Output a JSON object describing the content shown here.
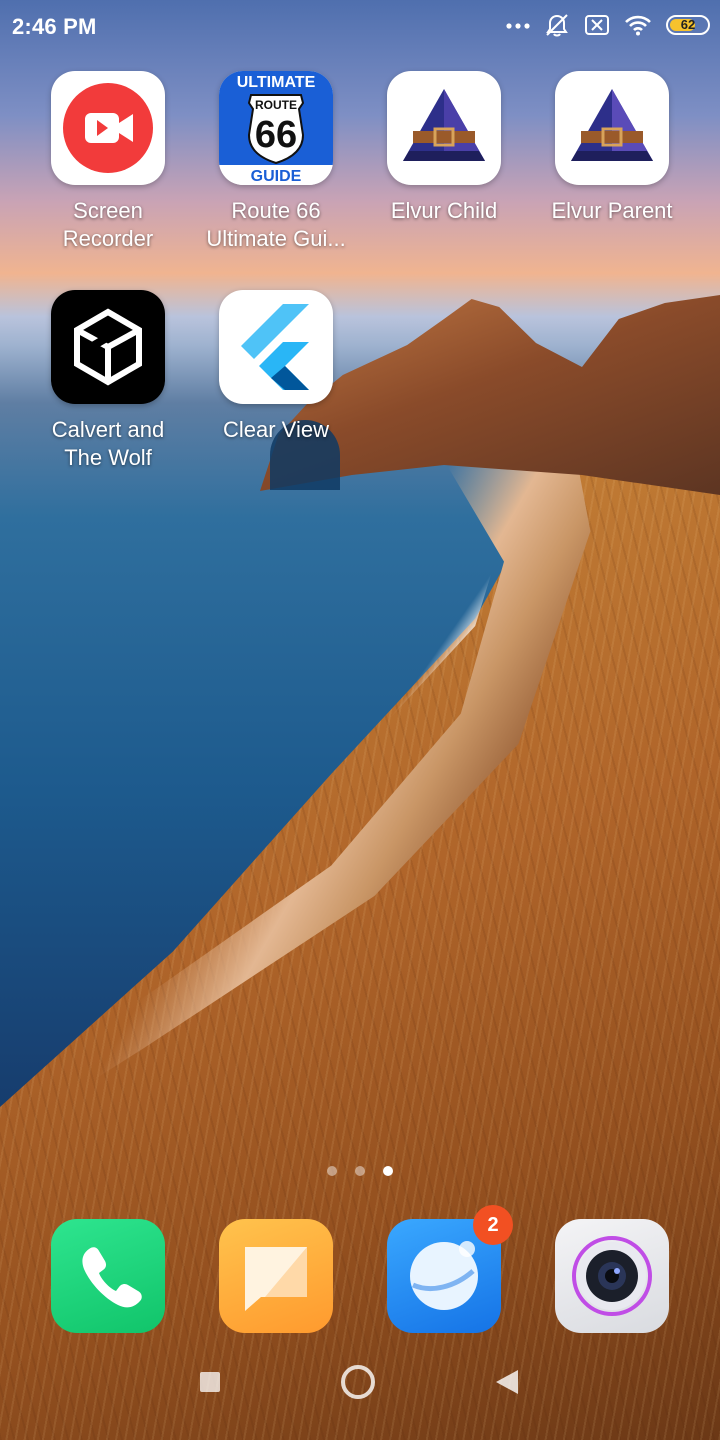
{
  "status_bar": {
    "time": "2:46 PM",
    "battery_level": "62",
    "icons": [
      "more-dots-icon",
      "silent-alarm-icon",
      "sim-x-icon",
      "wifi-icon",
      "battery-icon"
    ]
  },
  "apps": [
    {
      "label": "Screen\nRecorder",
      "icon": "screen-recorder-icon"
    },
    {
      "label": "Route 66\nUltimate Gui...",
      "icon": "route66-icon",
      "icon_text": {
        "top": "ULTIMATE",
        "shield": "ROUTE",
        "number": "66",
        "bottom": "GUIDE"
      }
    },
    {
      "label": "Elvur Child",
      "icon": "elvur-child-icon"
    },
    {
      "label": "Elvur Parent",
      "icon": "elvur-parent-icon"
    },
    {
      "label": "Calvert and\nThe Wolf",
      "icon": "unity-icon"
    },
    {
      "label": "Clear View",
      "icon": "flutter-icon"
    }
  ],
  "page_indicator": {
    "count": 3,
    "active_index": 2
  },
  "dock": [
    {
      "name": "phone",
      "icon": "phone-icon"
    },
    {
      "name": "messages",
      "icon": "messages-icon"
    },
    {
      "name": "browser",
      "icon": "browser-icon",
      "badge": "2"
    },
    {
      "name": "camera",
      "icon": "camera-icon"
    }
  ],
  "nav_bar": [
    "recents-icon",
    "home-icon",
    "back-icon"
  ],
  "colors": {
    "badge": "#f25022",
    "battery": "#f6c22d",
    "phone": "#1fd17a",
    "messages": "#ffae3a",
    "browser": "#1f8ff2"
  }
}
